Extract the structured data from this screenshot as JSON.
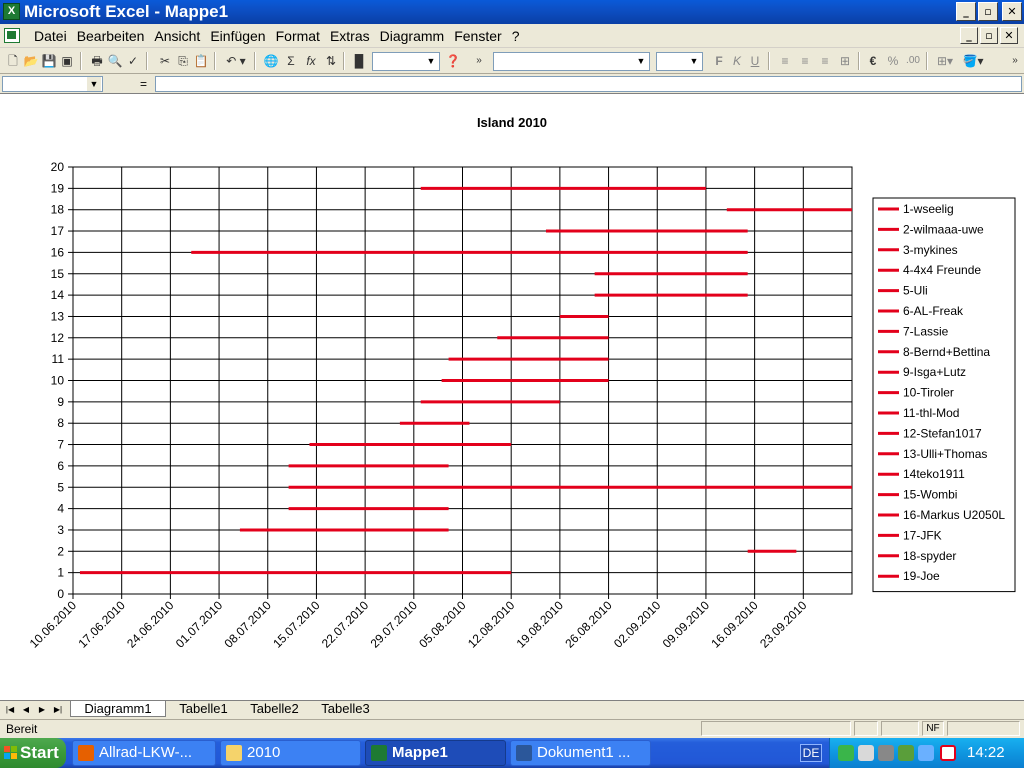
{
  "window": {
    "title": "Microsoft Excel - Mappe1",
    "icon_name": "excel-icon",
    "controls": [
      "minimize",
      "maximize",
      "close"
    ]
  },
  "menu": {
    "items": [
      "Datei",
      "Bearbeiten",
      "Ansicht",
      "Einfügen",
      "Format",
      "Extras",
      "Diagramm",
      "Fenster",
      "?"
    ]
  },
  "toolbar": {
    "icons": [
      "new-icon",
      "open-icon",
      "save-icon",
      "permission-icon",
      "print-icon",
      "print-preview-icon",
      "spelling-icon",
      "cut-icon",
      "copy-icon",
      "paste-icon",
      "undo-icon",
      "hyperlink-icon",
      "autosum-icon",
      "function-icon",
      "sort-icon",
      "chart-wizard-icon",
      "help-icon",
      "bold-icon",
      "italic-icon",
      "underline-icon",
      "align-left-icon",
      "align-center-icon",
      "align-right-icon",
      "merge-icon",
      "euro-icon",
      "percent-icon",
      "decimal-icon",
      "borders-icon",
      "fill-color-icon"
    ],
    "labels": {
      "sum": "Σ",
      "function": "fx",
      "bold": "F",
      "italic": "K",
      "underline": "U",
      "euro": "€"
    }
  },
  "formula_bar": {
    "equals": "="
  },
  "chart_data": {
    "type": "gantt",
    "title": "Island 2010",
    "y_ticks": [
      0,
      1,
      2,
      3,
      4,
      5,
      6,
      7,
      8,
      9,
      10,
      11,
      12,
      13,
      14,
      15,
      16,
      17,
      18,
      19,
      20
    ],
    "ylim": [
      0,
      20
    ],
    "x_tick_labels": [
      "10.06.2010",
      "17.06.2010",
      "24.06.2010",
      "01.07.2010",
      "08.07.2010",
      "15.07.2010",
      "22.07.2010",
      "29.07.2010",
      "05.08.2010",
      "12.08.2010",
      "19.08.2010",
      "26.08.2010",
      "02.09.2010",
      "09.09.2010",
      "16.09.2010",
      "23.09.2010"
    ],
    "xlim": [
      "10.06.2010",
      "30.09.2010"
    ],
    "grid": true,
    "legend_position": "right",
    "series_color": "#e3001b",
    "series": [
      {
        "name": "1-wseelig",
        "row": 1,
        "start": "11.06.2010",
        "end": "12.08.2010"
      },
      {
        "name": "2-wilmaaa-uwe",
        "row": 2,
        "start": "15.09.2010",
        "end": "22.09.2010"
      },
      {
        "name": "3-mykines",
        "row": 3,
        "start": "04.07.2010",
        "end": "03.08.2010"
      },
      {
        "name": "4-4x4 Freunde",
        "row": 4,
        "start": "11.07.2010",
        "end": "03.08.2010"
      },
      {
        "name": "5-Uli",
        "row": 5,
        "start": "11.07.2010",
        "end": "30.09.2010"
      },
      {
        "name": "6-AL-Freak",
        "row": 6,
        "start": "11.07.2010",
        "end": "03.08.2010"
      },
      {
        "name": "7-Lassie",
        "row": 7,
        "start": "14.07.2010",
        "end": "12.08.2010"
      },
      {
        "name": "8-Bernd+Bettina",
        "row": 8,
        "start": "27.07.2010",
        "end": "06.08.2010"
      },
      {
        "name": "9-Isga+Lutz",
        "row": 9,
        "start": "30.07.2010",
        "end": "19.08.2010"
      },
      {
        "name": "10-Tiroler",
        "row": 10,
        "start": "02.08.2010",
        "end": "26.08.2010"
      },
      {
        "name": "11-thl-Mod",
        "row": 11,
        "start": "03.08.2010",
        "end": "26.08.2010"
      },
      {
        "name": "12-Stefan1017",
        "row": 12,
        "start": "10.08.2010",
        "end": "26.08.2010"
      },
      {
        "name": "13-Ulli+Thomas",
        "row": 13,
        "start": "19.08.2010",
        "end": "26.08.2010"
      },
      {
        "name": "14teko1911",
        "row": 14,
        "start": "24.08.2010",
        "end": "15.09.2010"
      },
      {
        "name": "15-Wombi",
        "row": 15,
        "start": "24.08.2010",
        "end": "15.09.2010"
      },
      {
        "name": "16-Markus U2050L",
        "row": 16,
        "start": "27.06.2010",
        "end": "15.09.2010"
      },
      {
        "name": "17-JFK",
        "row": 17,
        "start": "17.08.2010",
        "end": "15.09.2010"
      },
      {
        "name": "18-spyder",
        "row": 18,
        "start": "12.09.2010",
        "end": "30.09.2010"
      },
      {
        "name": "19-Joe",
        "row": 19,
        "start": "30.07.2010",
        "end": "09.09.2010"
      }
    ]
  },
  "sheet_tabs": [
    "Diagramm1",
    "Tabelle1",
    "Tabelle2",
    "Tabelle3"
  ],
  "active_tab": 0,
  "status": {
    "text": "Bereit",
    "nf": "NF"
  },
  "taskbar": {
    "start_label": "Start",
    "buttons": [
      {
        "label": "Allrad-LKW-...",
        "icon": "firefox-icon",
        "active": false
      },
      {
        "label": "2010",
        "icon": "folder-icon",
        "active": false
      },
      {
        "label": "Mappe1",
        "icon": "excel-icon",
        "active": true
      },
      {
        "label": "Dokument1 ...",
        "icon": "word-icon",
        "active": false
      }
    ],
    "language": "DE",
    "clock": "14:22"
  }
}
